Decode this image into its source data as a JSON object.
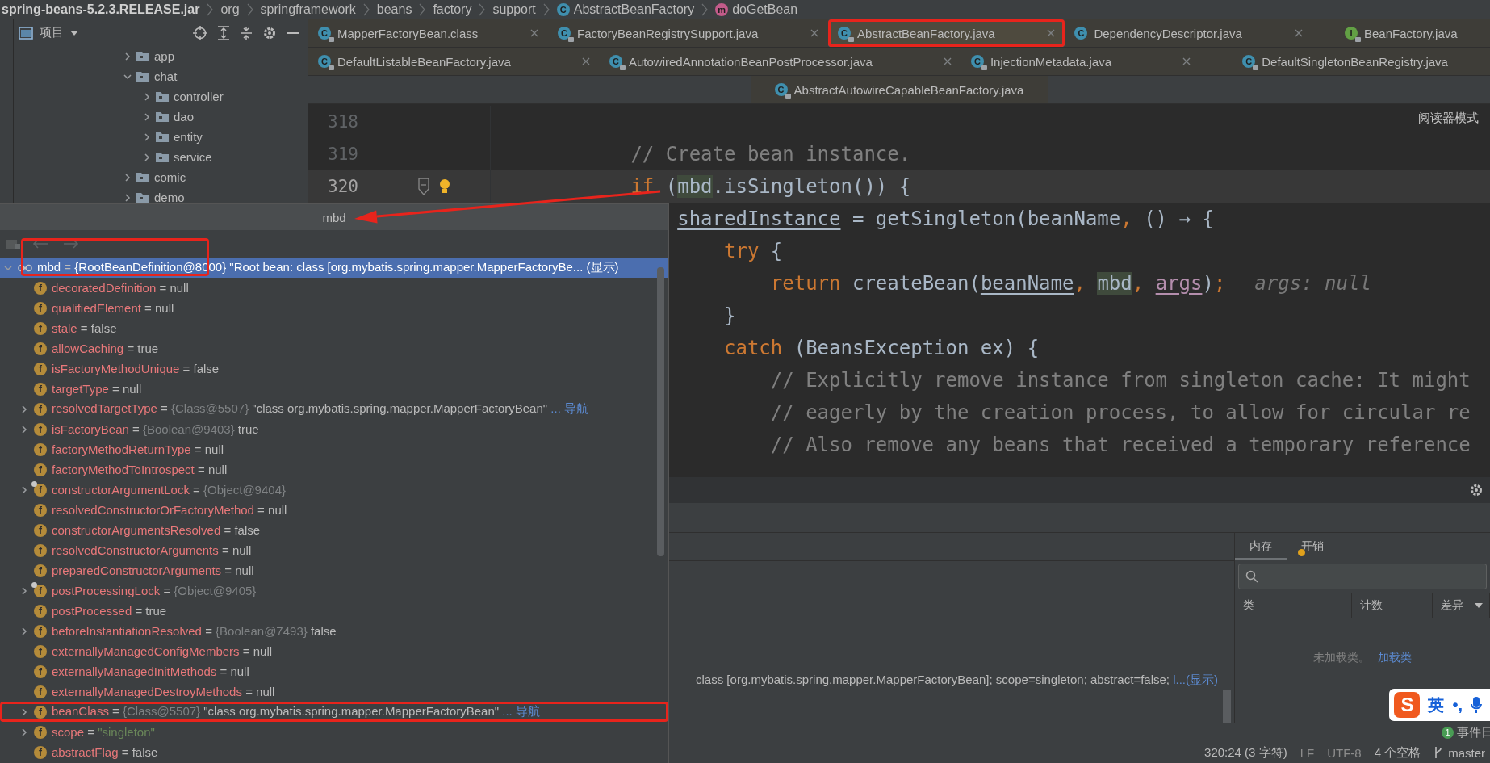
{
  "breadcrumb": [
    {
      "label": "spring-beans-5.2.3.RELEASE.jar",
      "kind": "jar"
    },
    {
      "label": "org",
      "kind": "package"
    },
    {
      "label": "springframework",
      "kind": "package"
    },
    {
      "label": "beans",
      "kind": "package"
    },
    {
      "label": "factory",
      "kind": "package"
    },
    {
      "label": "support",
      "kind": "package"
    },
    {
      "label": "AbstractBeanFactory",
      "kind": "class",
      "icon": "C"
    },
    {
      "label": "doGetBean",
      "kind": "method",
      "icon": "m"
    }
  ],
  "project": {
    "title": "项目",
    "tree": [
      {
        "label": "app",
        "expanded": false
      },
      {
        "label": "chat",
        "expanded": true,
        "children": [
          {
            "label": "controller",
            "expanded": false
          },
          {
            "label": "dao",
            "expanded": false
          },
          {
            "label": "entity",
            "expanded": false
          },
          {
            "label": "service",
            "expanded": false
          }
        ]
      },
      {
        "label": "comic",
        "expanded": false
      },
      {
        "label": "demo",
        "expanded": false
      }
    ]
  },
  "tab_rows": [
    [
      {
        "label": "MapperFactoryBean.class",
        "icon": "C",
        "kind": "class",
        "read_only": true,
        "closable": true,
        "selected": false,
        "highlighted": false
      },
      {
        "label": "FactoryBeanRegistrySupport.java",
        "icon": "C",
        "kind": "class",
        "read_only": true,
        "closable": true,
        "selected": false,
        "highlighted": false
      },
      {
        "label": "AbstractBeanFactory.java",
        "icon": "C",
        "kind": "class",
        "read_only": true,
        "closable": true,
        "selected": true,
        "highlighted": true
      },
      {
        "label": "DependencyDescriptor.java",
        "icon": "C",
        "kind": "class",
        "read_only": false,
        "closable": true,
        "selected": false,
        "highlighted": false
      },
      {
        "label": "BeanFactory.java",
        "icon": "I",
        "kind": "interface",
        "read_only": true,
        "closable": false,
        "selected": false,
        "highlighted": false
      }
    ],
    [
      {
        "label": "DefaultListableBeanFactory.java",
        "icon": "C",
        "kind": "class",
        "read_only": true,
        "closable": true,
        "selected": false,
        "highlighted": false
      },
      {
        "label": "AutowiredAnnotationBeanPostProcessor.java",
        "icon": "C",
        "kind": "class",
        "read_only": true,
        "closable": true,
        "selected": false,
        "highlighted": false
      },
      {
        "label": "InjectionMetadata.java",
        "icon": "C",
        "kind": "class",
        "read_only": true,
        "closable": true,
        "selected": false,
        "highlighted": false
      },
      {
        "label": "DefaultSingletonBeanRegistry.java",
        "icon": "C",
        "kind": "class",
        "read_only": true,
        "closable": false,
        "selected": false,
        "highlighted": false
      }
    ],
    [
      {
        "label": "AbstractAutowireCapableBeanFactory.java",
        "icon": "C",
        "kind": "class",
        "read_only": true,
        "closable": false,
        "selected": false,
        "highlighted": false
      }
    ]
  ],
  "editor": {
    "reader_mode": "阅读器模式",
    "lines": [
      {
        "number": "318",
        "current": false,
        "foldable": false,
        "bulb": false
      },
      {
        "number": "319",
        "current": false,
        "foldable": false,
        "bulb": false,
        "tokens": [
          {
            "text": "            // Create bean instance.",
            "kind": "comment"
          }
        ]
      },
      {
        "number": "320",
        "current": true,
        "foldable": true,
        "bulb": true,
        "tokens": [
          {
            "text": "            if",
            "kind": "keyword"
          },
          {
            "text": " (",
            "kind": "plain"
          },
          {
            "text": "mbd",
            "kind": "usage"
          },
          {
            "text": ".isSingleton()) {",
            "kind": "plain"
          }
        ]
      },
      {
        "current": false,
        "tokens": [
          {
            "text": "                sharedInstance",
            "kind": "underlined"
          },
          {
            "text": " = getSingleton(beanName",
            "kind": "plain"
          },
          {
            "text": ", ",
            "kind": "punct"
          },
          {
            "text": "() → {",
            "kind": "plain"
          }
        ]
      },
      {
        "current": false,
        "tokens": [
          {
            "text": "                    try",
            "kind": "keyword"
          },
          {
            "text": " {",
            "kind": "plain"
          }
        ]
      },
      {
        "current": false,
        "tokens": [
          {
            "text": "                        return",
            "kind": "keyword"
          },
          {
            "text": " createBean(",
            "kind": "plain"
          },
          {
            "text": "beanName",
            "kind": "underlined"
          },
          {
            "text": ", ",
            "kind": "punct"
          },
          {
            "text": "mbd",
            "kind": "usage"
          },
          {
            "text": ", ",
            "kind": "punct"
          },
          {
            "text": "args",
            "kind": "param"
          },
          {
            "text": ")",
            "kind": "plain"
          },
          {
            "text": ";",
            "kind": "punct"
          },
          {
            "text": "args: null",
            "kind": "hint"
          }
        ]
      },
      {
        "current": false,
        "tokens": [
          {
            "text": "                    }",
            "kind": "plain"
          }
        ]
      },
      {
        "current": false,
        "tokens": [
          {
            "text": "                    catch",
            "kind": "keyword"
          },
          {
            "text": " (BeansException ex) {",
            "kind": "plain"
          }
        ]
      },
      {
        "current": false,
        "tokens": [
          {
            "text": "                        // Explicitly remove instance from singleton cache: It might",
            "kind": "comment"
          }
        ]
      },
      {
        "current": false,
        "tokens": [
          {
            "text": "                        // eagerly by the creation process, to allow for circular re",
            "kind": "comment"
          }
        ]
      },
      {
        "current": false,
        "tokens": [
          {
            "text": "                        // Also remove any beans that received a temporary reference",
            "kind": "comment"
          }
        ]
      }
    ]
  },
  "debug": {
    "variable_preview": {
      "text": "class [org.mybatis.spring.mapper.MapperFactoryBean]; scope=singleton; abstract=false; ",
      "link": "l...(显示)"
    },
    "memory": {
      "tabs": [
        {
          "label": "内存",
          "selected": true,
          "badge": false
        },
        {
          "label": "开销",
          "selected": false,
          "badge": true
        }
      ],
      "columns": [
        "类",
        "计数",
        "差异"
      ],
      "empty_text": "未加载类。",
      "empty_link": "加载类"
    }
  },
  "status_bar": {
    "events": {
      "count": "1",
      "label": "事件日"
    },
    "items": [
      "320:24 (3 字符)",
      "LF",
      "UTF-8",
      "4 个空格"
    ],
    "branch": "master"
  },
  "ime": {
    "logo": "S",
    "mode": "英",
    "punct": "•,"
  },
  "popup": {
    "title": "mbd",
    "toolbar_highlighted": true,
    "nav_buttons": [
      {
        "kind": "back",
        "disabled": true
      },
      {
        "kind": "forward",
        "disabled": true
      }
    ],
    "tree": [
      {
        "kind": "watch",
        "name": "mbd",
        "op": "=",
        "ref": "{RootBeanDefinition@8000}",
        "value": "\"Root bean: class [org.mybatis.spring.mapper.MapperFactoryBe...",
        "link": "(显示)",
        "expanded": true,
        "selected": true,
        "highlighted": false,
        "children": [
          {
            "kind": "field",
            "icon": "f",
            "name": "decoratedDefinition",
            "op": "=",
            "value": "null",
            "string_value": false,
            "expandable": false,
            "expanded": false,
            "marked": false,
            "selected": false,
            "highlighted": false
          },
          {
            "kind": "field",
            "icon": "f",
            "name": "qualifiedElement",
            "op": "=",
            "value": "null",
            "string_value": false,
            "expandable": false,
            "expanded": false,
            "marked": false,
            "selected": false,
            "highlighted": false
          },
          {
            "kind": "field",
            "icon": "f",
            "name": "stale",
            "op": "=",
            "value": "false",
            "string_value": false,
            "expandable": false,
            "expanded": false,
            "marked": false,
            "selected": false,
            "highlighted": false
          },
          {
            "kind": "field",
            "icon": "f",
            "name": "allowCaching",
            "op": "=",
            "value": "true",
            "string_value": false,
            "expandable": false,
            "expanded": false,
            "marked": false,
            "selected": false,
            "highlighted": false
          },
          {
            "kind": "field",
            "icon": "f",
            "name": "isFactoryMethodUnique",
            "op": "=",
            "value": "false",
            "string_value": false,
            "expandable": false,
            "expanded": false,
            "marked": false,
            "selected": false,
            "highlighted": false
          },
          {
            "kind": "field",
            "icon": "f",
            "name": "targetType",
            "op": "=",
            "value": "null",
            "string_value": false,
            "expandable": false,
            "expanded": false,
            "marked": false,
            "selected": false,
            "highlighted": false
          },
          {
            "kind": "field",
            "icon": "f",
            "name": "resolvedTargetType",
            "op": "=",
            "ref": "{Class@5507}",
            "value": "\"class org.mybatis.spring.mapper.MapperFactoryBean\"",
            "string_value": false,
            "link": "... 导航",
            "expandable": true,
            "expanded": false,
            "marked": false,
            "selected": false,
            "highlighted": false
          },
          {
            "kind": "field",
            "icon": "f",
            "name": "isFactoryBean",
            "op": "=",
            "ref": "{Boolean@9403}",
            "value": "true",
            "string_value": false,
            "expandable": true,
            "expanded": false,
            "marked": false,
            "selected": false,
            "highlighted": false
          },
          {
            "kind": "field",
            "icon": "f",
            "name": "factoryMethodReturnType",
            "op": "=",
            "value": "null",
            "string_value": false,
            "expandable": false,
            "expanded": false,
            "marked": false,
            "selected": false,
            "highlighted": false
          },
          {
            "kind": "field",
            "icon": "f",
            "name": "factoryMethodToIntrospect",
            "op": "=",
            "value": "null",
            "string_value": false,
            "expandable": false,
            "expanded": false,
            "marked": false,
            "selected": false,
            "highlighted": false
          },
          {
            "kind": "field",
            "icon": "f",
            "name": "constructorArgumentLock",
            "op": "=",
            "ref": "{Object@9404}",
            "expandable": true,
            "expanded": false,
            "marked": true,
            "selected": false,
            "highlighted": false
          },
          {
            "kind": "field",
            "icon": "f",
            "name": "resolvedConstructorOrFactoryMethod",
            "op": "=",
            "value": "null",
            "string_value": false,
            "expandable": false,
            "expanded": false,
            "marked": false,
            "selected": false,
            "highlighted": false
          },
          {
            "kind": "field",
            "icon": "f",
            "name": "constructorArgumentsResolved",
            "op": "=",
            "value": "false",
            "string_value": false,
            "expandable": false,
            "expanded": false,
            "marked": false,
            "selected": false,
            "highlighted": false
          },
          {
            "kind": "field",
            "icon": "f",
            "name": "resolvedConstructorArguments",
            "op": "=",
            "value": "null",
            "string_value": false,
            "expandable": false,
            "expanded": false,
            "marked": false,
            "selected": false,
            "highlighted": false
          },
          {
            "kind": "field",
            "icon": "f",
            "name": "preparedConstructorArguments",
            "op": "=",
            "value": "null",
            "string_value": false,
            "expandable": false,
            "expanded": false,
            "marked": false,
            "selected": false,
            "highlighted": false
          },
          {
            "kind": "field",
            "icon": "f",
            "name": "postProcessingLock",
            "op": "=",
            "ref": "{Object@9405}",
            "expandable": true,
            "expanded": false,
            "marked": true,
            "selected": false,
            "highlighted": false
          },
          {
            "kind": "field",
            "icon": "f",
            "name": "postProcessed",
            "op": "=",
            "value": "true",
            "string_value": false,
            "expandable": false,
            "expanded": false,
            "marked": false,
            "selected": false,
            "highlighted": false
          },
          {
            "kind": "field",
            "icon": "f",
            "name": "beforeInstantiationResolved",
            "op": "=",
            "ref": "{Boolean@7493}",
            "value": "false",
            "string_value": false,
            "expandable": true,
            "expanded": false,
            "marked": false,
            "selected": false,
            "highlighted": false
          },
          {
            "kind": "field",
            "icon": "f",
            "name": "externallyManagedConfigMembers",
            "op": "=",
            "value": "null",
            "string_value": false,
            "expandable": false,
            "expanded": false,
            "marked": false,
            "selected": false,
            "highlighted": false
          },
          {
            "kind": "field",
            "icon": "f",
            "name": "externallyManagedInitMethods",
            "op": "=",
            "value": "null",
            "string_value": false,
            "expandable": false,
            "expanded": false,
            "marked": false,
            "selected": false,
            "highlighted": false
          },
          {
            "kind": "field",
            "icon": "f",
            "name": "externallyManagedDestroyMethods",
            "op": "=",
            "value": "null",
            "string_value": false,
            "expandable": false,
            "expanded": false,
            "marked": false,
            "selected": false,
            "highlighted": false
          },
          {
            "kind": "field",
            "icon": "f",
            "name": "beanClass",
            "op": "=",
            "ref": "{Class@5507}",
            "value": "\"class org.mybatis.spring.mapper.MapperFactoryBean\"",
            "string_value": false,
            "link": "... 导航",
            "expandable": true,
            "expanded": false,
            "marked": false,
            "selected": false,
            "highlighted": true
          },
          {
            "kind": "field",
            "icon": "f",
            "name": "scope",
            "op": "=",
            "value": "\"singleton\"",
            "string_value": true,
            "expandable": true,
            "expanded": false,
            "marked": false,
            "selected": false,
            "highlighted": false
          },
          {
            "kind": "field",
            "icon": "f",
            "name": "abstractFlag",
            "op": "=",
            "value": "false",
            "string_value": false,
            "expandable": false,
            "expanded": false,
            "marked": false,
            "selected": false,
            "highlighted": false
          }
        ]
      }
    ]
  }
}
